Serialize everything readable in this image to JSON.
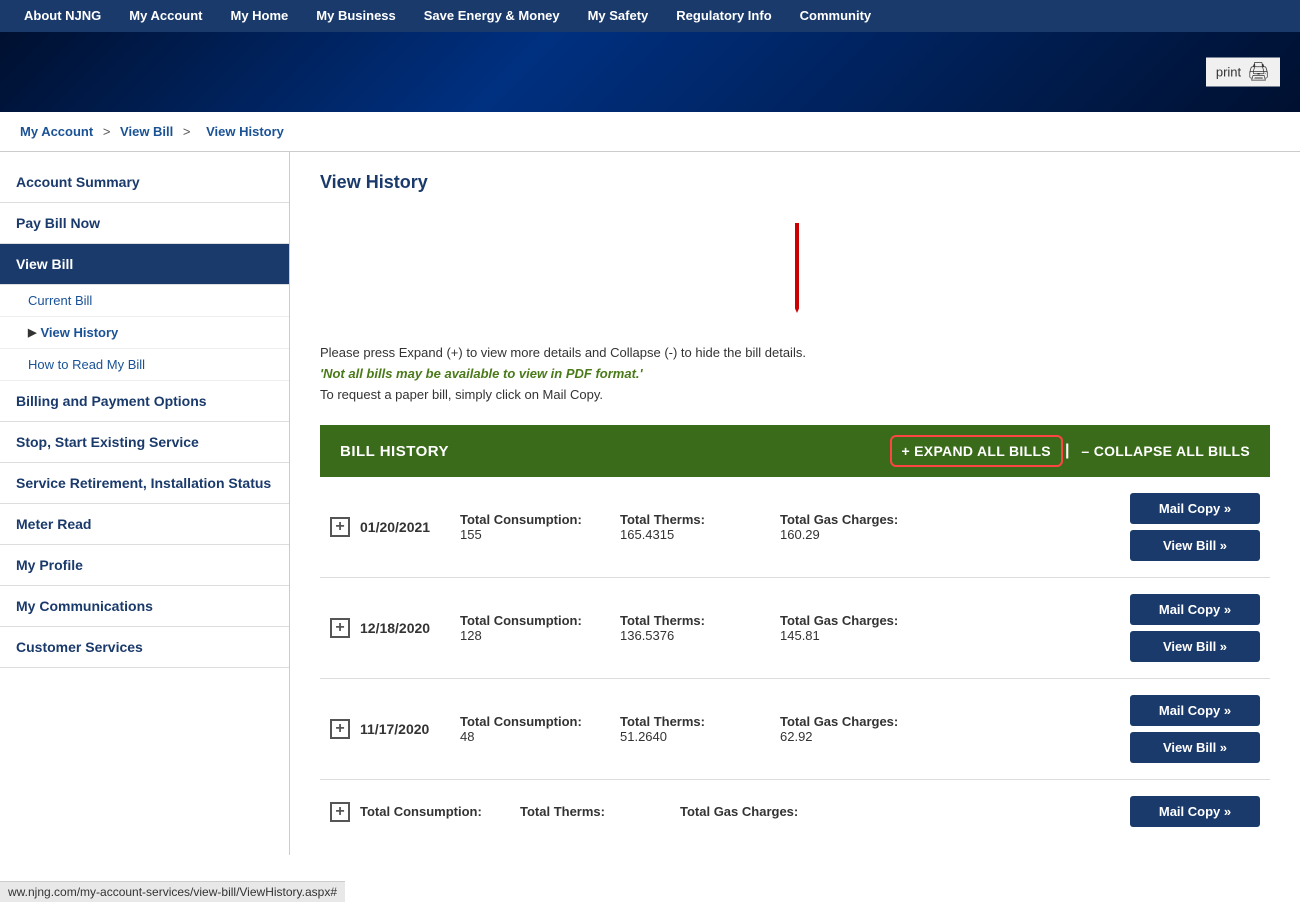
{
  "nav": {
    "items": [
      {
        "label": "About NJNG",
        "id": "about-njng"
      },
      {
        "label": "My Account",
        "id": "my-account"
      },
      {
        "label": "My Home",
        "id": "my-home"
      },
      {
        "label": "My Business",
        "id": "my-business"
      },
      {
        "label": "Save Energy & Money",
        "id": "save-energy"
      },
      {
        "label": "My Safety",
        "id": "my-safety"
      },
      {
        "label": "Regulatory Info",
        "id": "regulatory-info"
      },
      {
        "label": "Community",
        "id": "community"
      }
    ]
  },
  "print": {
    "label": "print"
  },
  "breadcrumb": {
    "account": "My Account",
    "viewbill": "View Bill",
    "current": "View History",
    "sep1": ">",
    "sep2": ">"
  },
  "sidebar": {
    "items": [
      {
        "label": "Account Summary",
        "id": "account-summary",
        "active": false
      },
      {
        "label": "Pay Bill Now",
        "id": "pay-bill-now",
        "active": false
      },
      {
        "label": "View Bill",
        "id": "view-bill",
        "active": true
      },
      {
        "label": "Current Bill",
        "id": "current-bill",
        "sub": true
      },
      {
        "label": "View History",
        "id": "view-history",
        "sub": true,
        "arrow": true
      },
      {
        "label": "How to Read My Bill",
        "id": "how-to-read",
        "sub": true
      },
      {
        "label": "Billing and Payment Options",
        "id": "billing-payment",
        "active": false
      },
      {
        "label": "Stop, Start Existing Service",
        "id": "stop-start",
        "active": false
      },
      {
        "label": "Service Retirement, Installation Status",
        "id": "service-retirement",
        "active": false
      },
      {
        "label": "Meter Read",
        "id": "meter-read",
        "active": false
      },
      {
        "label": "My Profile",
        "id": "my-profile",
        "active": false
      },
      {
        "label": "My Communications",
        "id": "my-communications",
        "active": false
      },
      {
        "label": "Customer Services",
        "id": "customer-services",
        "active": false
      }
    ]
  },
  "page": {
    "title": "View History",
    "instructions_line1": "Please press Expand (+) to view more details and Collapse (-) to hide the bill details.",
    "instructions_line2": "'Not all bills may be available to view in PDF format.'",
    "instructions_line3": "To request a paper bill, simply click on Mail Copy."
  },
  "bill_history": {
    "title": "BILL HISTORY",
    "expand_label": "+ EXPAND ALL BILLS",
    "separator": "|",
    "collapse_label": "– COLLAPSE ALL BILLS"
  },
  "bills": [
    {
      "date": "01/20/2021",
      "consumption_label": "Total Consumption:",
      "consumption_value": "155",
      "therms_label": "Total Therms:",
      "therms_value": "165.4315",
      "charges_label": "Total Gas Charges:",
      "charges_value": "160.29",
      "mail_copy": "Mail Copy »",
      "view_bill": "View Bill »"
    },
    {
      "date": "12/18/2020",
      "consumption_label": "Total Consumption:",
      "consumption_value": "128",
      "therms_label": "Total Therms:",
      "therms_value": "136.5376",
      "charges_label": "Total Gas Charges:",
      "charges_value": "145.81",
      "mail_copy": "Mail Copy »",
      "view_bill": "View Bill »"
    },
    {
      "date": "11/17/2020",
      "consumption_label": "Total Consumption:",
      "consumption_value": "48",
      "therms_label": "Total Therms:",
      "therms_value": "51.2640",
      "charges_label": "Total Gas Charges:",
      "charges_value": "62.92",
      "mail_copy": "Mail Copy »",
      "view_bill": "View Bill »"
    },
    {
      "date": "",
      "consumption_label": "Total Consumption:",
      "consumption_value": "",
      "therms_label": "Total Therms:",
      "therms_value": "",
      "charges_label": "Total Gas Charges:",
      "charges_value": "",
      "mail_copy": "Mail Copy »",
      "view_bill": ""
    }
  ],
  "url_bar": {
    "text": "ww.njng.com/my-account-services/view-bill/ViewHistory.aspx#"
  },
  "colors": {
    "nav_bg": "#1a3a6b",
    "sidebar_active": "#1a3a6b",
    "bill_history_bg": "#3a6b1a",
    "action_btn_bg": "#1a3a6b",
    "expand_border": "#ff4444",
    "red_arrow": "#cc0000",
    "green_text": "#4a7a1a"
  }
}
